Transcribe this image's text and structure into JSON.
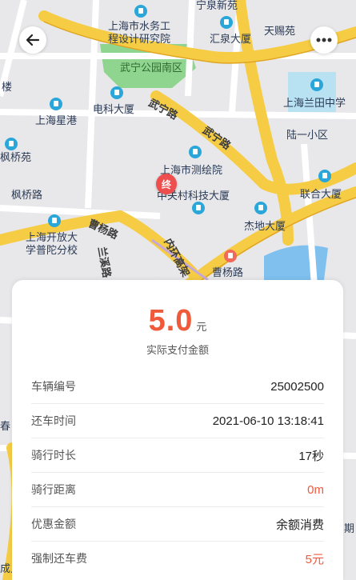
{
  "map": {
    "labels": [
      {
        "id": "label-shuiwu",
        "text": "上海市水务工"
      },
      {
        "id": "label-shuiwu2",
        "text": "程设计研究院"
      },
      {
        "id": "label-huiquan",
        "text": "汇泉大厦"
      },
      {
        "id": "label-tianci",
        "text": "天赐苑"
      },
      {
        "id": "label-park",
        "text": "武宁公园南区"
      },
      {
        "id": "label-lou",
        "text": "楼"
      },
      {
        "id": "label-dianke",
        "text": "电科大厦"
      },
      {
        "id": "label-lantian",
        "text": "上海兰田中学"
      },
      {
        "id": "label-xinggang",
        "text": "上海星港"
      },
      {
        "id": "label-wuning1",
        "text": "武宁路"
      },
      {
        "id": "label-wuning2",
        "text": "武宁路"
      },
      {
        "id": "label-luyi",
        "text": "陆一小区"
      },
      {
        "id": "label-fengyuan",
        "text": "枫桥苑"
      },
      {
        "id": "label-cehui",
        "text": "上海市测绘院"
      },
      {
        "id": "label-fengqiao",
        "text": "枫桥路"
      },
      {
        "id": "label-zhongguancun",
        "text": "中关村科技大厦"
      },
      {
        "id": "label-lianhe",
        "text": "联合大厦"
      },
      {
        "id": "label-caoyang1",
        "text": "曹杨路"
      },
      {
        "id": "label-jiedi",
        "text": "杰地大厦"
      },
      {
        "id": "label-kaifang1",
        "text": "上海开放大"
      },
      {
        "id": "label-kaifang2",
        "text": "学普陀分校"
      },
      {
        "id": "label-neihuan",
        "text": "内环高架"
      },
      {
        "id": "label-caoyang2",
        "text": "曹杨路"
      },
      {
        "id": "label-lanxi",
        "text": "兰溪路"
      },
      {
        "id": "label-chun",
        "text": "春"
      },
      {
        "id": "label-cheng",
        "text": "成入"
      },
      {
        "id": "label-qi",
        "text": "期"
      },
      {
        "id": "label-top1",
        "text": "宁泉新苑"
      }
    ],
    "end_marker_text": "终"
  },
  "card": {
    "amount": "5.0",
    "unit": "元",
    "caption": "实际支付金额",
    "rows": [
      {
        "label": "车辆编号",
        "value": "25002500",
        "color": "normal"
      },
      {
        "label": "还车时间",
        "value": "2021-06-10 13:18:41",
        "color": "normal"
      },
      {
        "label": "骑行时长",
        "value": "17秒",
        "color": "normal"
      },
      {
        "label": "骑行距离",
        "value": "0m",
        "color": "red"
      },
      {
        "label": "优惠金额",
        "value": "余额消费",
        "color": "normal"
      },
      {
        "label": "强制还车费",
        "value": "5元",
        "color": "red"
      }
    ]
  },
  "colors": {
    "accent": "#ee5a3a",
    "road_major": "#f5cc44",
    "park": "#8fd48f",
    "water": "#7fc0ef"
  }
}
